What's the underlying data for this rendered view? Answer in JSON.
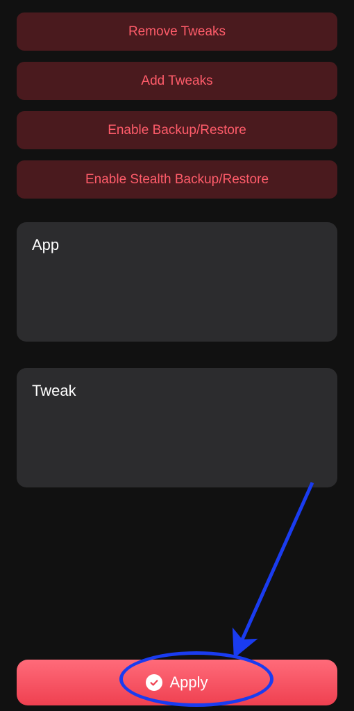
{
  "actions": {
    "remove_tweaks": "Remove Tweaks",
    "add_tweaks": "Add Tweaks",
    "enable_backup": "Enable Backup/Restore",
    "enable_stealth_backup": "Enable Stealth Backup/Restore"
  },
  "cards": {
    "app_title": "App",
    "tweak_title": "Tweak"
  },
  "apply": {
    "label": "Apply"
  }
}
